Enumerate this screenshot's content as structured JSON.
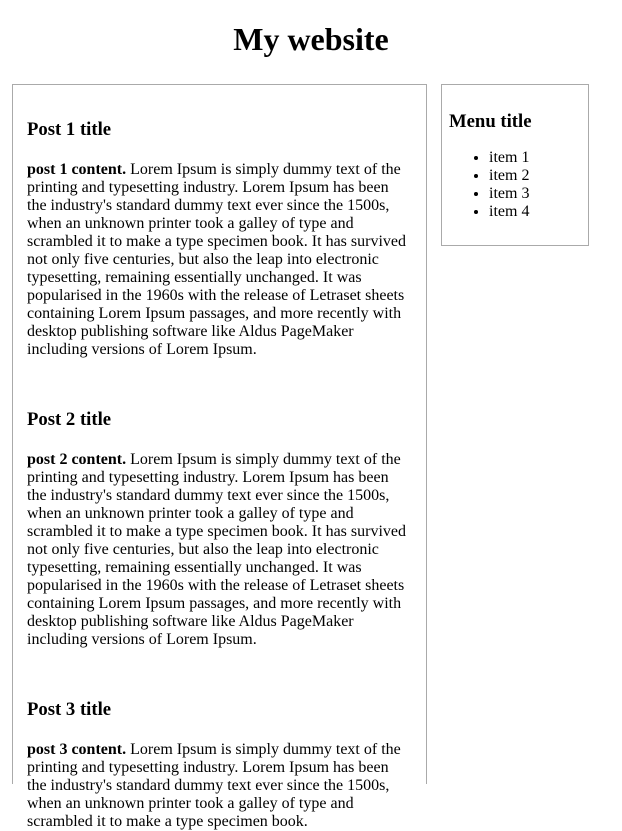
{
  "header": {
    "title": "My website"
  },
  "posts": [
    {
      "title": "Post 1 title",
      "lead": "post 1 content.",
      "body": " Lorem Ipsum is simply dummy text of the printing and typesetting industry. Lorem Ipsum has been the industry's standard dummy text ever since the 1500s, when an unknown printer took a galley of type and scrambled it to make a type specimen book. It has survived not only five centuries, but also the leap into electronic typesetting, remaining essentially unchanged. It was popularised in the 1960s with the release of Letraset sheets containing Lorem Ipsum passages, and more recently with desktop publishing software like Aldus PageMaker including versions of Lorem Ipsum."
    },
    {
      "title": "Post 2 title",
      "lead": "post 2 content.",
      "body": " Lorem Ipsum is simply dummy text of the printing and typesetting industry. Lorem Ipsum has been the industry's standard dummy text ever since the 1500s, when an unknown printer took a galley of type and scrambled it to make a type specimen book. It has survived not only five centuries, but also the leap into electronic typesetting, remaining essentially unchanged. It was popularised in the 1960s with the release of Letraset sheets containing Lorem Ipsum passages, and more recently with desktop publishing software like Aldus PageMaker including versions of Lorem Ipsum."
    },
    {
      "title": "Post 3 title",
      "lead": "post 3 content.",
      "body": " Lorem Ipsum is simply dummy text of the printing and typesetting industry. Lorem Ipsum has been the industry's standard dummy text ever since the 1500s, when an unknown printer took a galley of type and scrambled it to make a type specimen book."
    }
  ],
  "sidebar": {
    "title": "Menu title",
    "items": [
      "item 1",
      "item 2",
      "item 3",
      "item 4"
    ]
  },
  "colors": {
    "border": "#aaaaaa",
    "text": "#000000",
    "background": "#ffffff"
  }
}
